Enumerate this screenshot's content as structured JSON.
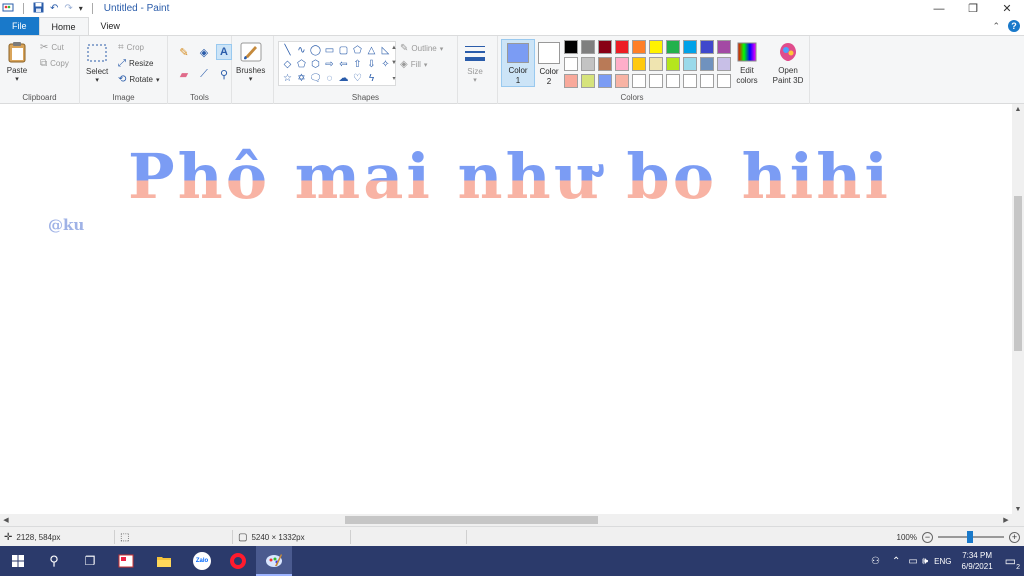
{
  "app": {
    "title": "Untitled - Paint"
  },
  "tabs": {
    "file": "File",
    "home": "Home",
    "view": "View"
  },
  "ribbon": {
    "clipboard": {
      "paste": "Paste",
      "cut": "Cut",
      "copy": "Copy",
      "label": "Clipboard"
    },
    "image": {
      "select": "Select",
      "crop": "Crop",
      "resize": "Resize",
      "rotate": "Rotate",
      "label": "Image"
    },
    "tools": {
      "label": "Tools"
    },
    "brushes": {
      "label": "Brushes"
    },
    "shapes": {
      "outline": "Outline",
      "fill": "Fill",
      "label": "Shapes"
    },
    "size": {
      "label": "Size"
    },
    "colors": {
      "color1": "Color 1",
      "color2": "Color 2",
      "color1_value": "#7b9cf4",
      "color2_value": "#ffffff",
      "edit": "Edit colors",
      "label": "Colors",
      "palette": [
        "#000000",
        "#7f7f7f",
        "#880015",
        "#ed1c24",
        "#ff7f27",
        "#fff200",
        "#22b14c",
        "#00a2e8",
        "#3f48cc",
        "#a349a4",
        "#ffffff",
        "#c3c3c3",
        "#b97a57",
        "#ffaec9",
        "#ffc90e",
        "#efe4b0",
        "#b5e61d",
        "#99d9ea",
        "#7092be",
        "#c8bfe7",
        "#f8a99b",
        "#d6e37c",
        "#7b9cf4",
        "#f8b3a4",
        "#ffffff",
        "#ffffff",
        "#ffffff",
        "#ffffff",
        "#ffffff",
        "#ffffff"
      ]
    },
    "paint3d": {
      "label": "Open Paint 3D"
    }
  },
  "canvas": {
    "headline": "Phô mai như bo hihi",
    "signature": "@ku",
    "top_color": "#7b9cf4",
    "bottom_color": "#f8b3a4"
  },
  "status": {
    "cursor_pos": "2128, 584px",
    "image_size": "5240 × 1332px",
    "zoom": "100%"
  },
  "taskbar": {
    "apps": [
      "start-icon",
      "search-icon",
      "task-view-icon",
      "snipping-icon",
      "file-explorer-icon",
      "zalo-icon",
      "opera-icon",
      "paint-icon"
    ],
    "lang": "ENG",
    "time": "7:34 PM",
    "date": "6/9/2021",
    "notifications": "2"
  }
}
